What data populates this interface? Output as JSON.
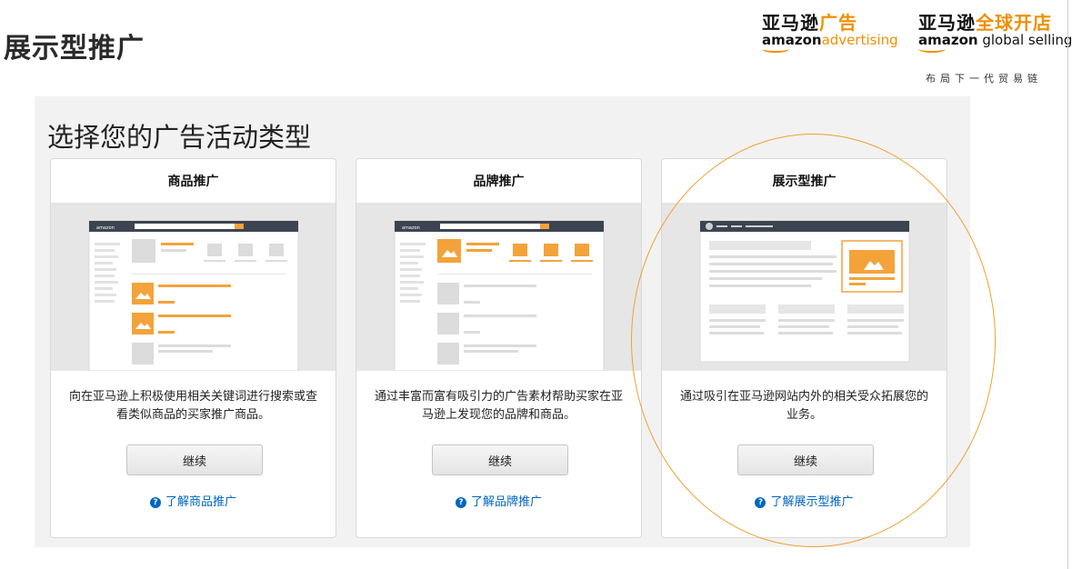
{
  "slide": {
    "title": "展示型推广"
  },
  "brands": [
    {
      "cn_prefix": "亚马逊",
      "cn_accent": "广告",
      "en_bold": "amazon",
      "en_rest": "advertising"
    },
    {
      "cn_prefix": "亚马逊",
      "cn_accent": "全球开店",
      "en_bold": "amazon",
      "en_rest": " global selling"
    }
  ],
  "tagline": "布局下一代贸易链",
  "panel": {
    "heading": "选择您的广告活动类型"
  },
  "cards": [
    {
      "title": "商品推广",
      "description": "向在亚马逊上积极使用相关关键词进行搜索或查看类似商品的买家推广商品。",
      "button": "继续",
      "link": "了解商品推广",
      "preview_brand": "amazon"
    },
    {
      "title": "品牌推广",
      "description": "通过丰富而富有吸引力的广告素材帮助买家在亚马逊上发现您的品牌和商品。",
      "button": "继续",
      "link": "了解品牌推广",
      "preview_brand": "amazon"
    },
    {
      "title": "展示型推广",
      "description": "通过吸引在亚马逊网站内外的相关受众拓展您的业务。",
      "button": "继续",
      "link": "了解展示型推广"
    }
  ],
  "colors": {
    "accent": "#f3a33a",
    "link": "#0066c0",
    "highlight_ring": "#f0a030"
  },
  "icons": {
    "help": "question-circle-icon",
    "image_placeholder": "image-icon"
  }
}
